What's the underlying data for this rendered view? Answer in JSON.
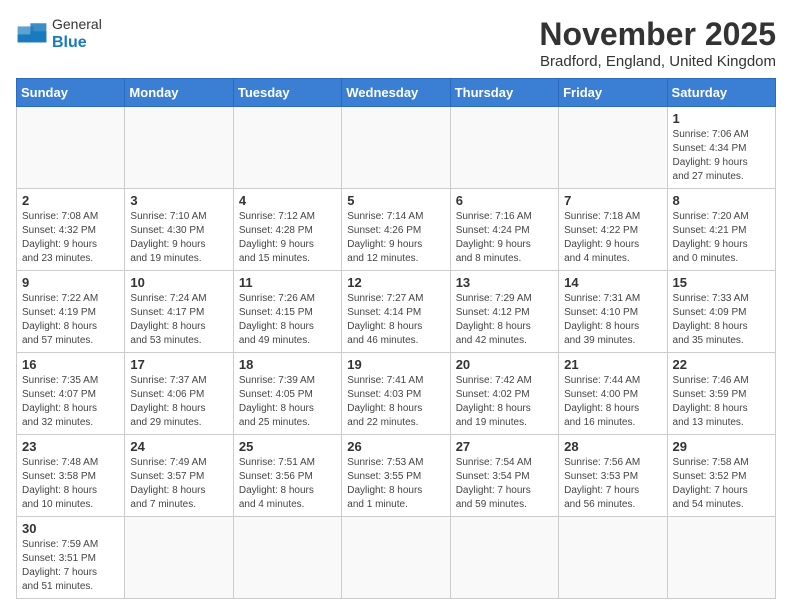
{
  "header": {
    "logo_general": "General",
    "logo_blue": "Blue",
    "month_title": "November 2025",
    "location": "Bradford, England, United Kingdom"
  },
  "weekdays": [
    "Sunday",
    "Monday",
    "Tuesday",
    "Wednesday",
    "Thursday",
    "Friday",
    "Saturday"
  ],
  "weeks": [
    [
      {
        "day": "",
        "info": ""
      },
      {
        "day": "",
        "info": ""
      },
      {
        "day": "",
        "info": ""
      },
      {
        "day": "",
        "info": ""
      },
      {
        "day": "",
        "info": ""
      },
      {
        "day": "",
        "info": ""
      },
      {
        "day": "1",
        "info": "Sunrise: 7:06 AM\nSunset: 4:34 PM\nDaylight: 9 hours\nand 27 minutes."
      }
    ],
    [
      {
        "day": "2",
        "info": "Sunrise: 7:08 AM\nSunset: 4:32 PM\nDaylight: 9 hours\nand 23 minutes."
      },
      {
        "day": "3",
        "info": "Sunrise: 7:10 AM\nSunset: 4:30 PM\nDaylight: 9 hours\nand 19 minutes."
      },
      {
        "day": "4",
        "info": "Sunrise: 7:12 AM\nSunset: 4:28 PM\nDaylight: 9 hours\nand 15 minutes."
      },
      {
        "day": "5",
        "info": "Sunrise: 7:14 AM\nSunset: 4:26 PM\nDaylight: 9 hours\nand 12 minutes."
      },
      {
        "day": "6",
        "info": "Sunrise: 7:16 AM\nSunset: 4:24 PM\nDaylight: 9 hours\nand 8 minutes."
      },
      {
        "day": "7",
        "info": "Sunrise: 7:18 AM\nSunset: 4:22 PM\nDaylight: 9 hours\nand 4 minutes."
      },
      {
        "day": "8",
        "info": "Sunrise: 7:20 AM\nSunset: 4:21 PM\nDaylight: 9 hours\nand 0 minutes."
      }
    ],
    [
      {
        "day": "9",
        "info": "Sunrise: 7:22 AM\nSunset: 4:19 PM\nDaylight: 8 hours\nand 57 minutes."
      },
      {
        "day": "10",
        "info": "Sunrise: 7:24 AM\nSunset: 4:17 PM\nDaylight: 8 hours\nand 53 minutes."
      },
      {
        "day": "11",
        "info": "Sunrise: 7:26 AM\nSunset: 4:15 PM\nDaylight: 8 hours\nand 49 minutes."
      },
      {
        "day": "12",
        "info": "Sunrise: 7:27 AM\nSunset: 4:14 PM\nDaylight: 8 hours\nand 46 minutes."
      },
      {
        "day": "13",
        "info": "Sunrise: 7:29 AM\nSunset: 4:12 PM\nDaylight: 8 hours\nand 42 minutes."
      },
      {
        "day": "14",
        "info": "Sunrise: 7:31 AM\nSunset: 4:10 PM\nDaylight: 8 hours\nand 39 minutes."
      },
      {
        "day": "15",
        "info": "Sunrise: 7:33 AM\nSunset: 4:09 PM\nDaylight: 8 hours\nand 35 minutes."
      }
    ],
    [
      {
        "day": "16",
        "info": "Sunrise: 7:35 AM\nSunset: 4:07 PM\nDaylight: 8 hours\nand 32 minutes."
      },
      {
        "day": "17",
        "info": "Sunrise: 7:37 AM\nSunset: 4:06 PM\nDaylight: 8 hours\nand 29 minutes."
      },
      {
        "day": "18",
        "info": "Sunrise: 7:39 AM\nSunset: 4:05 PM\nDaylight: 8 hours\nand 25 minutes."
      },
      {
        "day": "19",
        "info": "Sunrise: 7:41 AM\nSunset: 4:03 PM\nDaylight: 8 hours\nand 22 minutes."
      },
      {
        "day": "20",
        "info": "Sunrise: 7:42 AM\nSunset: 4:02 PM\nDaylight: 8 hours\nand 19 minutes."
      },
      {
        "day": "21",
        "info": "Sunrise: 7:44 AM\nSunset: 4:00 PM\nDaylight: 8 hours\nand 16 minutes."
      },
      {
        "day": "22",
        "info": "Sunrise: 7:46 AM\nSunset: 3:59 PM\nDaylight: 8 hours\nand 13 minutes."
      }
    ],
    [
      {
        "day": "23",
        "info": "Sunrise: 7:48 AM\nSunset: 3:58 PM\nDaylight: 8 hours\nand 10 minutes."
      },
      {
        "day": "24",
        "info": "Sunrise: 7:49 AM\nSunset: 3:57 PM\nDaylight: 8 hours\nand 7 minutes."
      },
      {
        "day": "25",
        "info": "Sunrise: 7:51 AM\nSunset: 3:56 PM\nDaylight: 8 hours\nand 4 minutes."
      },
      {
        "day": "26",
        "info": "Sunrise: 7:53 AM\nSunset: 3:55 PM\nDaylight: 8 hours\nand 1 minute."
      },
      {
        "day": "27",
        "info": "Sunrise: 7:54 AM\nSunset: 3:54 PM\nDaylight: 7 hours\nand 59 minutes."
      },
      {
        "day": "28",
        "info": "Sunrise: 7:56 AM\nSunset: 3:53 PM\nDaylight: 7 hours\nand 56 minutes."
      },
      {
        "day": "29",
        "info": "Sunrise: 7:58 AM\nSunset: 3:52 PM\nDaylight: 7 hours\nand 54 minutes."
      }
    ],
    [
      {
        "day": "30",
        "info": "Sunrise: 7:59 AM\nSunset: 3:51 PM\nDaylight: 7 hours\nand 51 minutes."
      },
      {
        "day": "",
        "info": ""
      },
      {
        "day": "",
        "info": ""
      },
      {
        "day": "",
        "info": ""
      },
      {
        "day": "",
        "info": ""
      },
      {
        "day": "",
        "info": ""
      },
      {
        "day": "",
        "info": ""
      }
    ]
  ]
}
